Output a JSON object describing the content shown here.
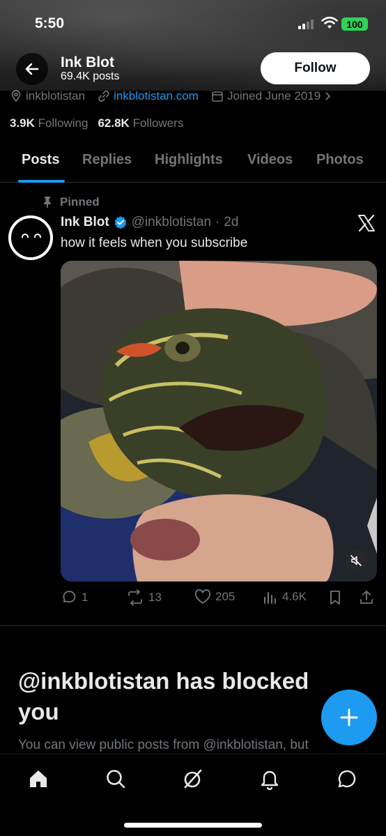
{
  "status_bar": {
    "time": "5:50",
    "battery": "100"
  },
  "header": {
    "name": "Ink Blot",
    "posts": "69.4K posts",
    "follow_label": "Follow"
  },
  "profile_meta": {
    "location": "inkblotistan",
    "website": "inkblotistan.com",
    "joined": "Joined June 2019"
  },
  "follows": {
    "following_count": "3.9K",
    "following_label": "Following",
    "followers_count": "62.8K",
    "followers_label": "Followers"
  },
  "tabs": [
    {
      "label": "Posts",
      "active": true
    },
    {
      "label": "Replies"
    },
    {
      "label": "Highlights"
    },
    {
      "label": "Videos"
    },
    {
      "label": "Photos"
    }
  ],
  "pinned_post": {
    "pinned_label": "Pinned",
    "author": "Ink Blot",
    "handle": "@inkblotistan",
    "time": "2d",
    "text": "how it feels when you subscribe",
    "stats": {
      "replies": "1",
      "reposts": "13",
      "likes": "205",
      "views": "4.6K"
    }
  },
  "blocked": {
    "title": "@inkblotistan has blocked you",
    "description": "You can view public posts from @inkblotistan, but"
  },
  "colors": {
    "accent": "#1d9bf0",
    "background": "#000000",
    "muted": "#71767b",
    "battery": "#30d158"
  },
  "icons": [
    "back-arrow-icon",
    "location-icon",
    "link-icon",
    "calendar-icon",
    "chevron-right-icon",
    "pin-icon",
    "verified-badge-icon",
    "x-logo-icon",
    "mute-icon",
    "reply-icon",
    "repost-icon",
    "like-icon",
    "views-icon",
    "bookmark-icon",
    "share-icon",
    "plus-icon",
    "home-icon",
    "search-icon",
    "grok-icon",
    "notifications-icon",
    "messages-icon"
  ]
}
